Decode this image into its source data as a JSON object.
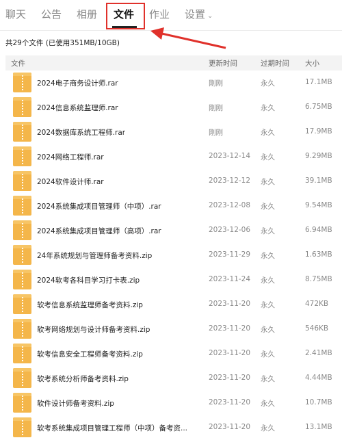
{
  "tabs": [
    {
      "label": "聊天",
      "active": false
    },
    {
      "label": "公告",
      "active": false
    },
    {
      "label": "相册",
      "active": false
    },
    {
      "label": "文件",
      "active": true
    },
    {
      "label": "作业",
      "active": false
    },
    {
      "label": "设置",
      "active": false
    }
  ],
  "summary": "共29个文件 (已使用351MB/10GB)",
  "columns": {
    "file": "文件",
    "updated": "更新时间",
    "expire": "过期时间",
    "size": "大小"
  },
  "files": [
    {
      "name": "2024电子商务设计师.rar",
      "time": "刚刚",
      "expire": "永久",
      "size": "17.1MB"
    },
    {
      "name": "2024信息系统监理师.rar",
      "time": "刚刚",
      "expire": "永久",
      "size": "6.75MB"
    },
    {
      "name": "2024数据库系统工程师.rar",
      "time": "刚刚",
      "expire": "永久",
      "size": "17.9MB"
    },
    {
      "name": "2024网络工程师.rar",
      "time": "2023-12-14",
      "expire": "永久",
      "size": "9.29MB"
    },
    {
      "name": "2024软件设计师.rar",
      "time": "2023-12-12",
      "expire": "永久",
      "size": "39.1MB"
    },
    {
      "name": "2024系统集成项目管理师（中项）.rar",
      "time": "2023-12-08",
      "expire": "永久",
      "size": "9.54MB"
    },
    {
      "name": "2024系统集成项目管理师（高项）.rar",
      "time": "2023-12-06",
      "expire": "永久",
      "size": "6.94MB"
    },
    {
      "name": "24年系统规划与管理师备考资料.zip",
      "time": "2023-11-29",
      "expire": "永久",
      "size": "1.63MB"
    },
    {
      "name": "2024软考各科目学习打卡表.zip",
      "time": "2023-11-24",
      "expire": "永久",
      "size": "8.75MB"
    },
    {
      "name": "软考信息系统监理师备考资料.zip",
      "time": "2023-11-20",
      "expire": "永久",
      "size": "472KB"
    },
    {
      "name": "软考网络规划与设计师备考资料.zip",
      "time": "2023-11-20",
      "expire": "永久",
      "size": "546KB"
    },
    {
      "name": "软考信息安全工程师备考资料.zip",
      "time": "2023-11-20",
      "expire": "永久",
      "size": "2.41MB"
    },
    {
      "name": "软考系统分析师备考资料.zip",
      "time": "2023-11-20",
      "expire": "永久",
      "size": "4.44MB"
    },
    {
      "name": "软件设计师备考资料.zip",
      "time": "2023-11-20",
      "expire": "永久",
      "size": "10.7MB"
    },
    {
      "name": "软考系统集成项目管理工程师（中项）备考资...",
      "time": "2023-11-20",
      "expire": "永久",
      "size": "13.1MB"
    }
  ],
  "colors": {
    "folder": "#f4b64a",
    "highlight": "#e0312b"
  },
  "icons": {
    "file": "zip-folder-icon",
    "settings_dropdown": "chevron-down-icon"
  }
}
